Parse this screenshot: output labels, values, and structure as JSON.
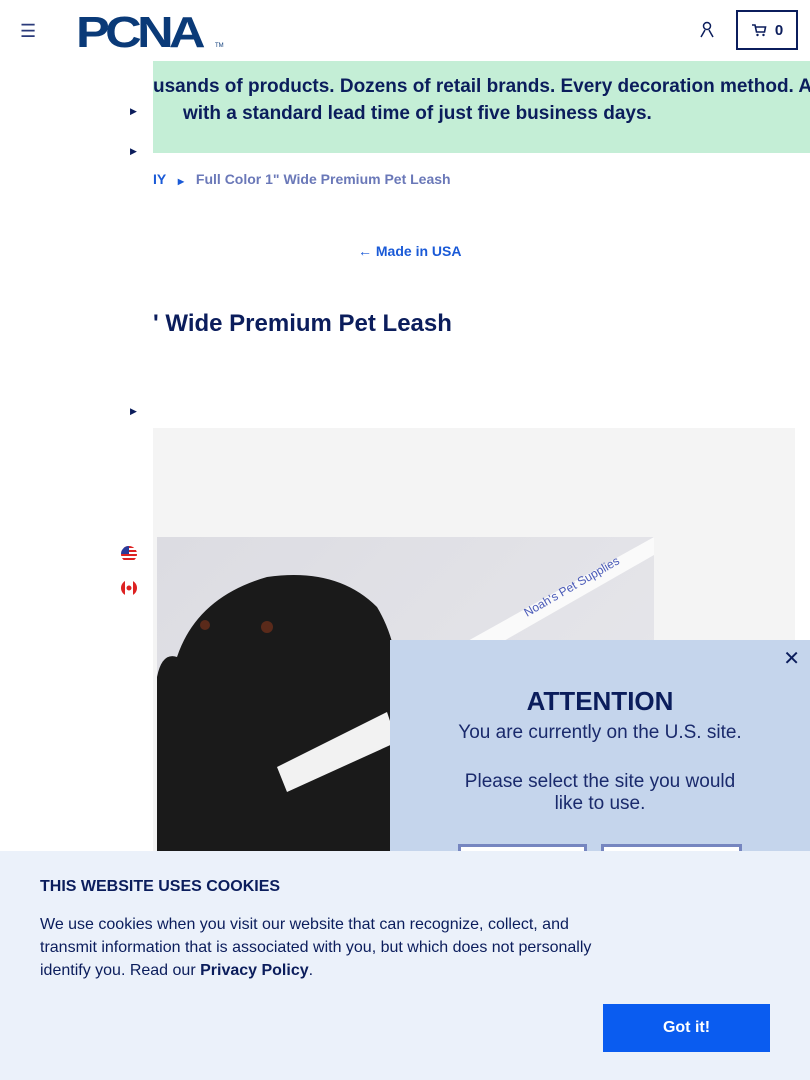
{
  "header": {
    "logo": "PCNA",
    "tm": "TM",
    "cart_count": "0"
  },
  "banner": {
    "line1": "usands of products. Dozens of retail brands. Every decoration method. All",
    "line2": "with a standard lead time of just five business days."
  },
  "breadcrumb": {
    "prev": "IY",
    "current": "Full Color 1\" Wide Premium Pet Leash"
  },
  "back_link": "Made in USA",
  "product": {
    "title": "' Wide Premium Pet Leash",
    "image_text": "Noah's Pet Supplies"
  },
  "modal": {
    "close": "✕",
    "title": "ATTENTION",
    "line1": "You are currently on the U.S. site.",
    "line2": "Please select the site you would like to use."
  },
  "cookie": {
    "title": "THIS WEBSITE USES COOKIES",
    "text": "We use cookies when you visit our website that can recognize, collect, and transmit information that is associated with you, but which does not personally identify you. Read our ",
    "link": "Privacy Policy",
    "end": ".",
    "button": "Got it!"
  }
}
